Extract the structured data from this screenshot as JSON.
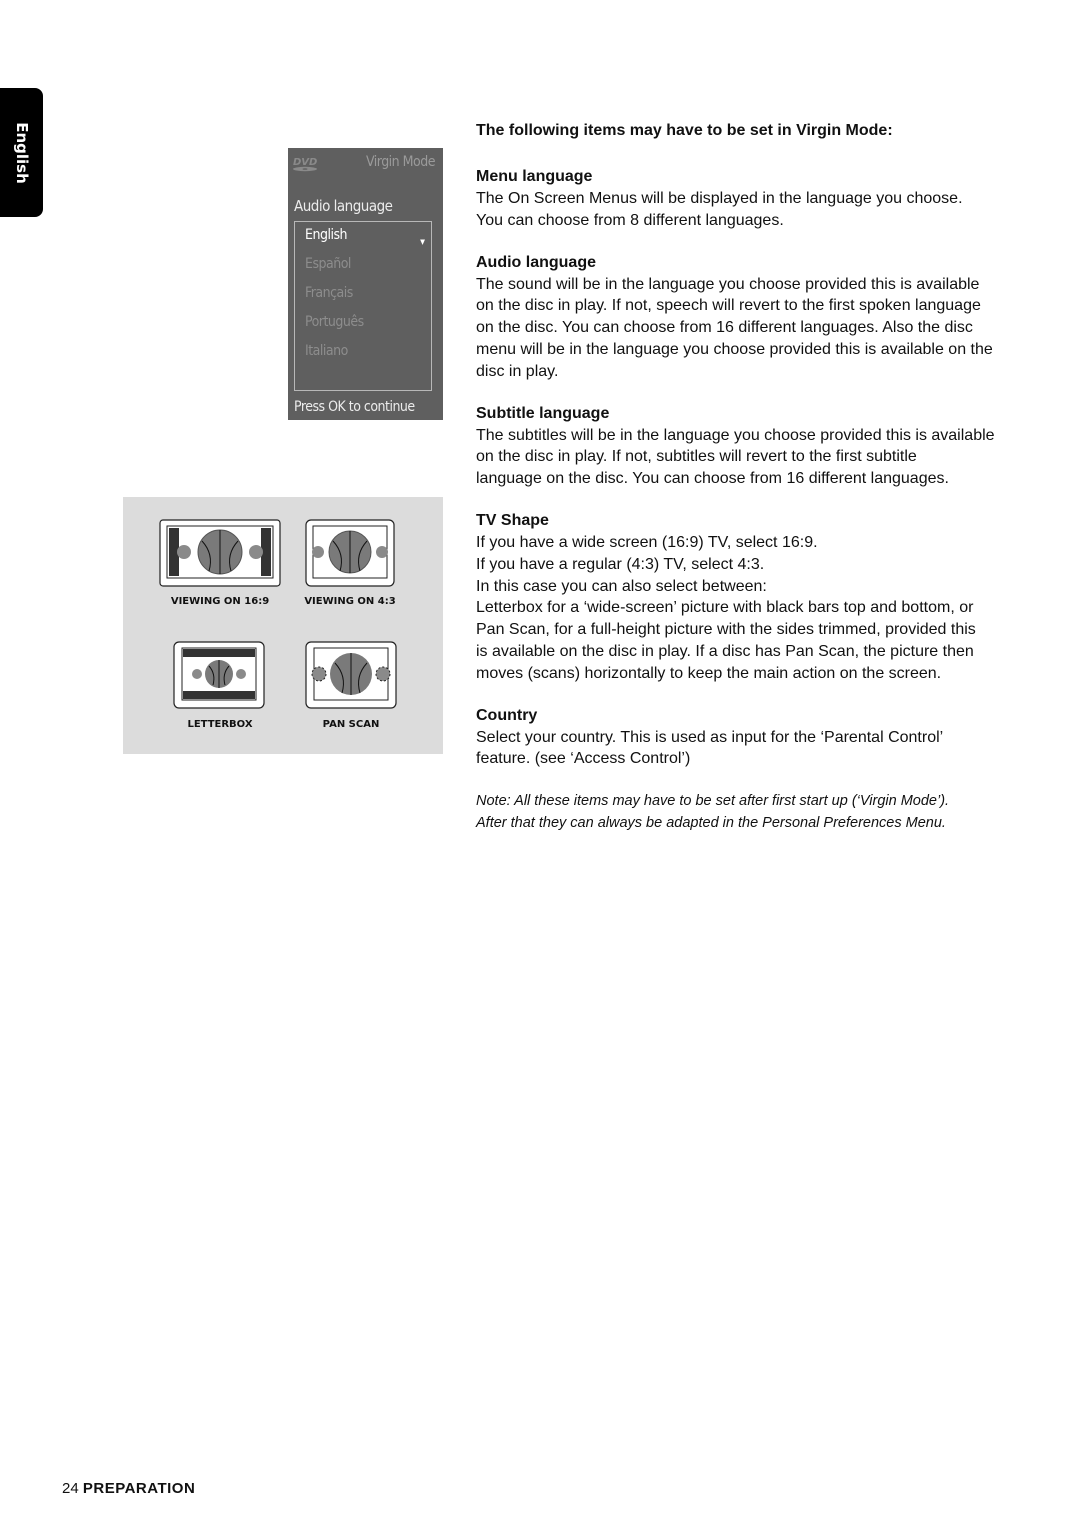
{
  "side_tab": {
    "label": "English"
  },
  "osd_menu": {
    "mode_label": "Virgin Mode",
    "logo": "dvd-logo",
    "title": "Audio language",
    "options": [
      "English",
      "Español",
      "Français",
      "Português",
      "Italiano"
    ],
    "selected_index": 0,
    "footer": "Press OK to continue"
  },
  "illustrations": [
    {
      "label": "VIEWING ON 16:9",
      "type": "widescreen"
    },
    {
      "label": "VIEWING ON 4:3",
      "type": "regular"
    },
    {
      "label": "LETTERBOX",
      "type": "letterbox"
    },
    {
      "label": "PAN SCAN",
      "type": "panscan"
    }
  ],
  "content": {
    "intro": "The following items may have to be set in Virgin Mode:",
    "sections": [
      {
        "heading": "Menu language",
        "lines": [
          "The On Screen Menus will be displayed in the language you choose.",
          "You can choose from 8 different languages."
        ]
      },
      {
        "heading": "Audio language",
        "lines": [
          "The sound will be in the language you choose provided this is available",
          "on the disc in play. If not, speech will revert to the first spoken language",
          "on the disc. You can choose from 16 different languages. Also the disc",
          "menu will be in the language you choose provided this is available on the",
          "disc in play."
        ]
      },
      {
        "heading": "Subtitle language",
        "lines": [
          "The subtitles will be in the language you choose provided this is available",
          "on the disc in play. If not, subtitles will revert to the first subtitle",
          "language on the disc. You can choose from 16 different languages."
        ]
      },
      {
        "heading": "TV Shape",
        "lines": [
          "If you have a wide screen (16:9) TV, select 16:9.",
          "If you have a regular (4:3) TV, select 4:3.",
          "In this case you can also select between:",
          "Letterbox for a ‘wide-screen’ picture with black bars top and bottom, or",
          "Pan Scan, for a full-height picture with the sides trimmed, provided this",
          "is available on the disc in play. If a disc has Pan Scan, the picture then",
          "moves (scans) horizontally to keep the main action on the screen."
        ]
      },
      {
        "heading": "Country",
        "lines": [
          "Select your country. This is used as input for the ‘Parental Control’",
          "feature. (see ‘Access Control’)"
        ]
      }
    ],
    "note_lines": [
      "Note: All these items may have to be set after first start up (‘Virgin Mode’).",
      "After that they can always be adapted in the Personal Preferences Menu."
    ]
  },
  "footer": {
    "page_number": "24",
    "section": "PREPARATION"
  }
}
